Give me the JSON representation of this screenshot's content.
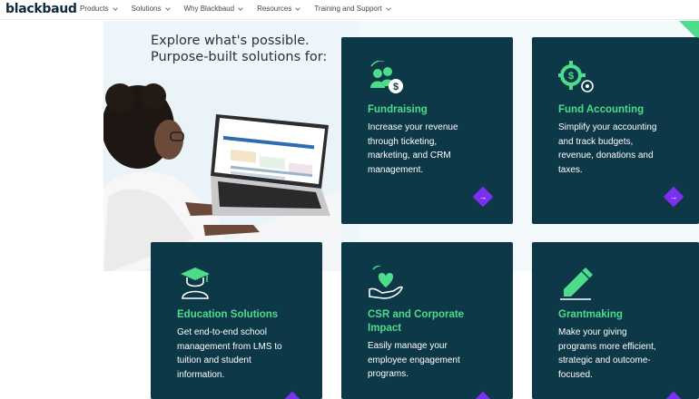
{
  "header": {
    "logo": "blackbaud",
    "nav": [
      "Products",
      "Solutions",
      "Why Blackbaud",
      "Resources",
      "Training and Support"
    ]
  },
  "hero": {
    "line1": "Explore what's possible.",
    "line2": "Purpose-built solutions for:"
  },
  "cards": [
    {
      "title": "Fundraising",
      "desc": [
        "Increase your revenue",
        "through ticketing,",
        "marketing, and CRM",
        "management."
      ],
      "icon": "fundraising-people-dollar-icon"
    },
    {
      "title": "Fund Accounting",
      "desc": [
        "Simplify your accounting",
        "and track budgets,",
        "revenue, donations and",
        "taxes."
      ],
      "icon": "gear-dollar-icon"
    },
    {
      "title": "Education Solutions",
      "desc": [
        "Get end-to-end school",
        "management from LMS to",
        "tuition and student",
        "information."
      ],
      "icon": "graduation-cap-icon"
    },
    {
      "title": "CSR and Corporate Impact",
      "title_lines": [
        "CSR and Corporate",
        "Impact"
      ],
      "desc": [
        "Easily manage your",
        "employee engagement",
        "programs."
      ],
      "icon": "hand-heart-icon"
    },
    {
      "title": "Grantmaking",
      "desc": [
        "Make your giving",
        "programs more efficient,",
        "strategic and outcome-",
        "focused."
      ],
      "icon": "pencil-icon"
    }
  ],
  "colors": {
    "card_bg": "#0d3847",
    "accent_green": "#4ddc8c",
    "arrow_purple": "#7b2ff0"
  }
}
